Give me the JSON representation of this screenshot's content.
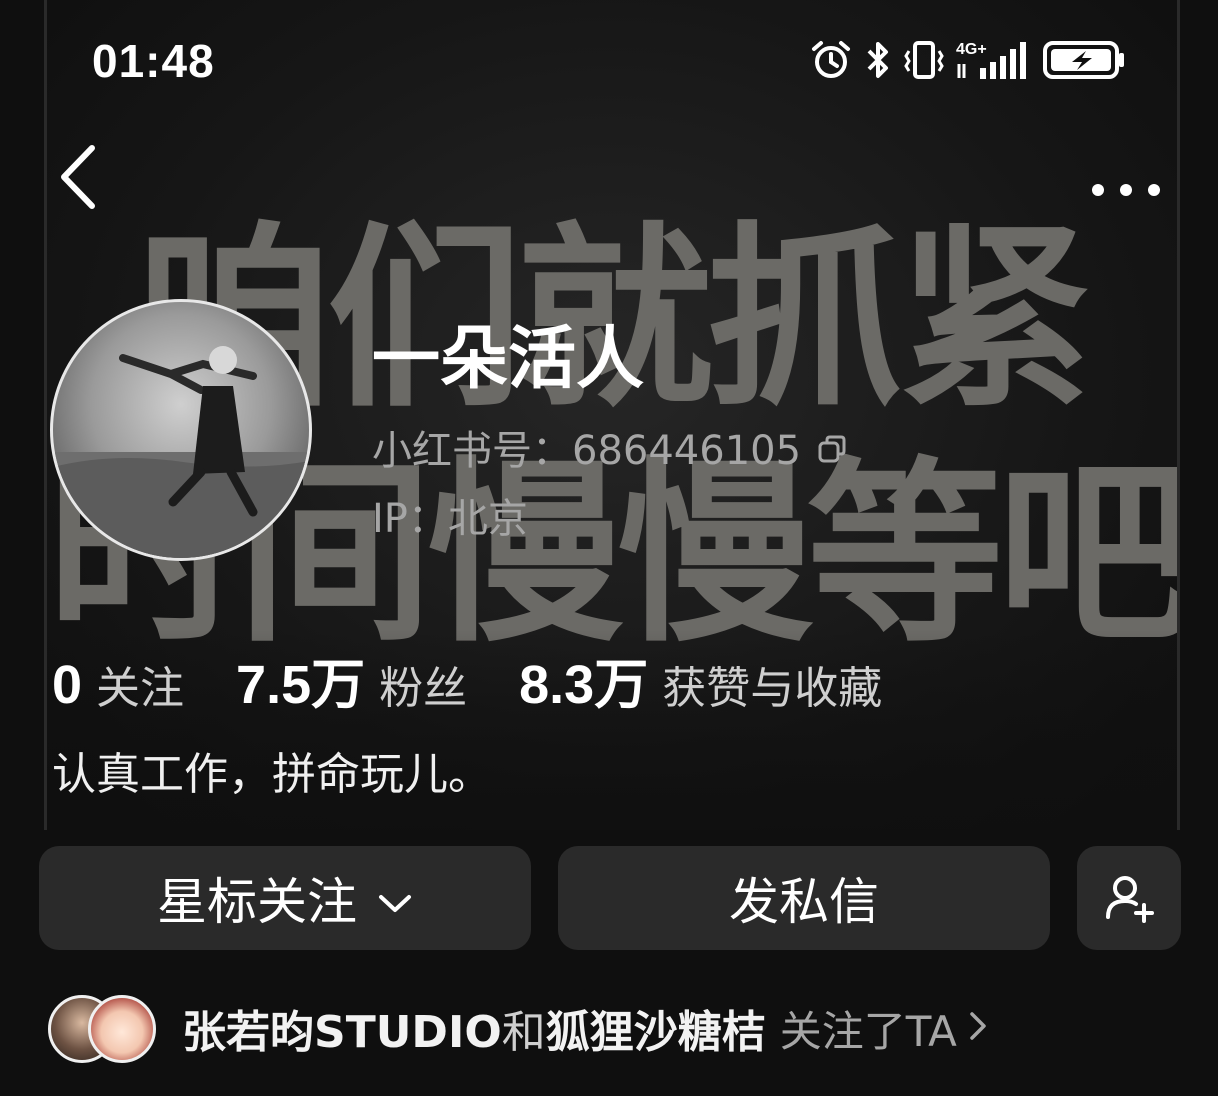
{
  "status_bar": {
    "time": "01:48",
    "icons": [
      "alarm-icon",
      "bluetooth-icon",
      "vibrate-icon",
      "signal-4g-icon",
      "battery-charging-icon"
    ],
    "network": "4G+"
  },
  "nav": {
    "back_icon": "chevron-left-icon",
    "more_icon": "more-horizontal-icon"
  },
  "background": {
    "line1": "咱们就抓紧",
    "line2": "时间慢慢等吧。"
  },
  "profile": {
    "name": "一朵活人",
    "id_label": "小红书号：686446105",
    "ip_label": "IP：北京",
    "bio": "认真工作，拼命玩儿。"
  },
  "stats": {
    "following_count": "0",
    "following_label": "关注",
    "followers_count": "7.5万",
    "followers_label": "粉丝",
    "likes_count": "8.3万",
    "likes_label": "获赞与收藏"
  },
  "actions": {
    "star_follow": "星标关注",
    "message": "发私信",
    "add_friend_icon": "add-user-icon"
  },
  "mutual": {
    "name1": "张若昀STUDIO",
    "and": "和",
    "name2": "狐狸沙糖桔",
    "suffix": "关注了TA"
  },
  "colors": {
    "background": "#0f0f0f",
    "button": "#2a2a2a",
    "secondary_text": "#a6a6a6"
  }
}
